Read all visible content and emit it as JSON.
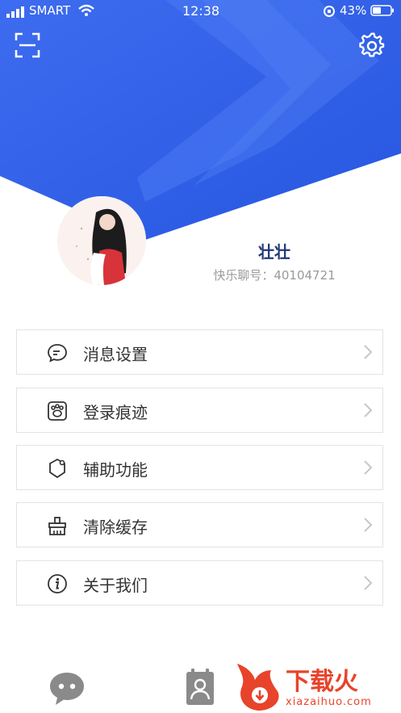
{
  "status_bar": {
    "carrier": "SMART",
    "time": "12:38",
    "battery": "43%"
  },
  "profile": {
    "name": "壮壮",
    "id_label": "快乐聊号：",
    "id_value": "40104721"
  },
  "menu": [
    {
      "label": "消息设置",
      "icon": "message-bubble-icon"
    },
    {
      "label": "登录痕迹",
      "icon": "paw-icon"
    },
    {
      "label": "辅助功能",
      "icon": "shield-icon"
    },
    {
      "label": "清除缓存",
      "icon": "broom-icon"
    },
    {
      "label": "关于我们",
      "icon": "info-icon"
    }
  ],
  "watermark": {
    "brand": "下载火",
    "url": "xiazaihuo.com"
  },
  "colors": {
    "header_blue": "#2f5fe6",
    "name_text": "#233a7a",
    "watermark": "#e8432b"
  }
}
